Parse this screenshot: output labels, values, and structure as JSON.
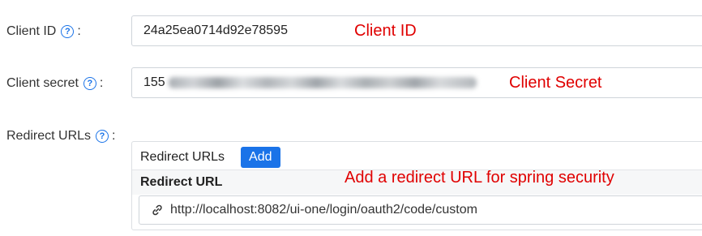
{
  "client_id": {
    "label": "Client ID",
    "separator": ":",
    "value": "24a25ea0714d92e78595",
    "annotation": "Client ID"
  },
  "client_secret": {
    "label": "Client secret",
    "separator": ":",
    "value_visible_prefix": "155",
    "annotation": "Client Secret"
  },
  "redirect_urls": {
    "label": "Redirect URLs",
    "separator": ":",
    "panel_title": "Redirect URLs",
    "add_button": "Add",
    "column_header": "Redirect URL",
    "annotation": "Add a redirect URL for spring security",
    "items": [
      "http://localhost:8082/ui-one/login/oauth2/code/custom"
    ]
  },
  "icons": {
    "help": "question-circle-icon",
    "link": "link-icon"
  },
  "colors": {
    "accent": "#1a73e8",
    "annotation": "#e00000"
  }
}
